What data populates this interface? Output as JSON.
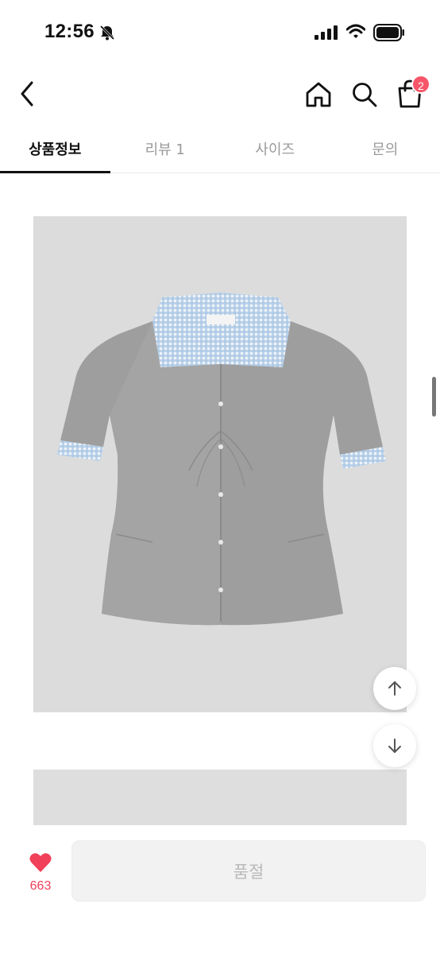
{
  "status_bar": {
    "time": "12:56",
    "icons": [
      "bell-slash-icon",
      "cellular-signal-icon",
      "wifi-icon",
      "battery-icon"
    ]
  },
  "nav": {
    "back_icon": "chevron-left-icon",
    "home_icon": "home-icon",
    "search_icon": "search-icon",
    "cart_icon": "shopping-bag-icon",
    "cart_count": "2"
  },
  "tabs": [
    {
      "label": "상품정보",
      "active": true
    },
    {
      "label": "리뷰 1",
      "active": false
    },
    {
      "label": "사이즈",
      "active": false
    },
    {
      "label": "문의",
      "active": false
    }
  ],
  "product": {
    "image_subject": "gray short-sleeve shirt with gingham check collar and cuffs",
    "floating_buttons": [
      "arrow-up-icon",
      "arrow-down-icon"
    ]
  },
  "bottom_bar": {
    "like_icon": "heart-icon",
    "like_count": "663",
    "purchase_button_label": "품절"
  },
  "colors": {
    "accent": "#f7566a",
    "like": "#f0405a",
    "image_bg": "#dcdcdc",
    "shirt": "#9c9c9c",
    "gingham": "#a9c6e4"
  }
}
